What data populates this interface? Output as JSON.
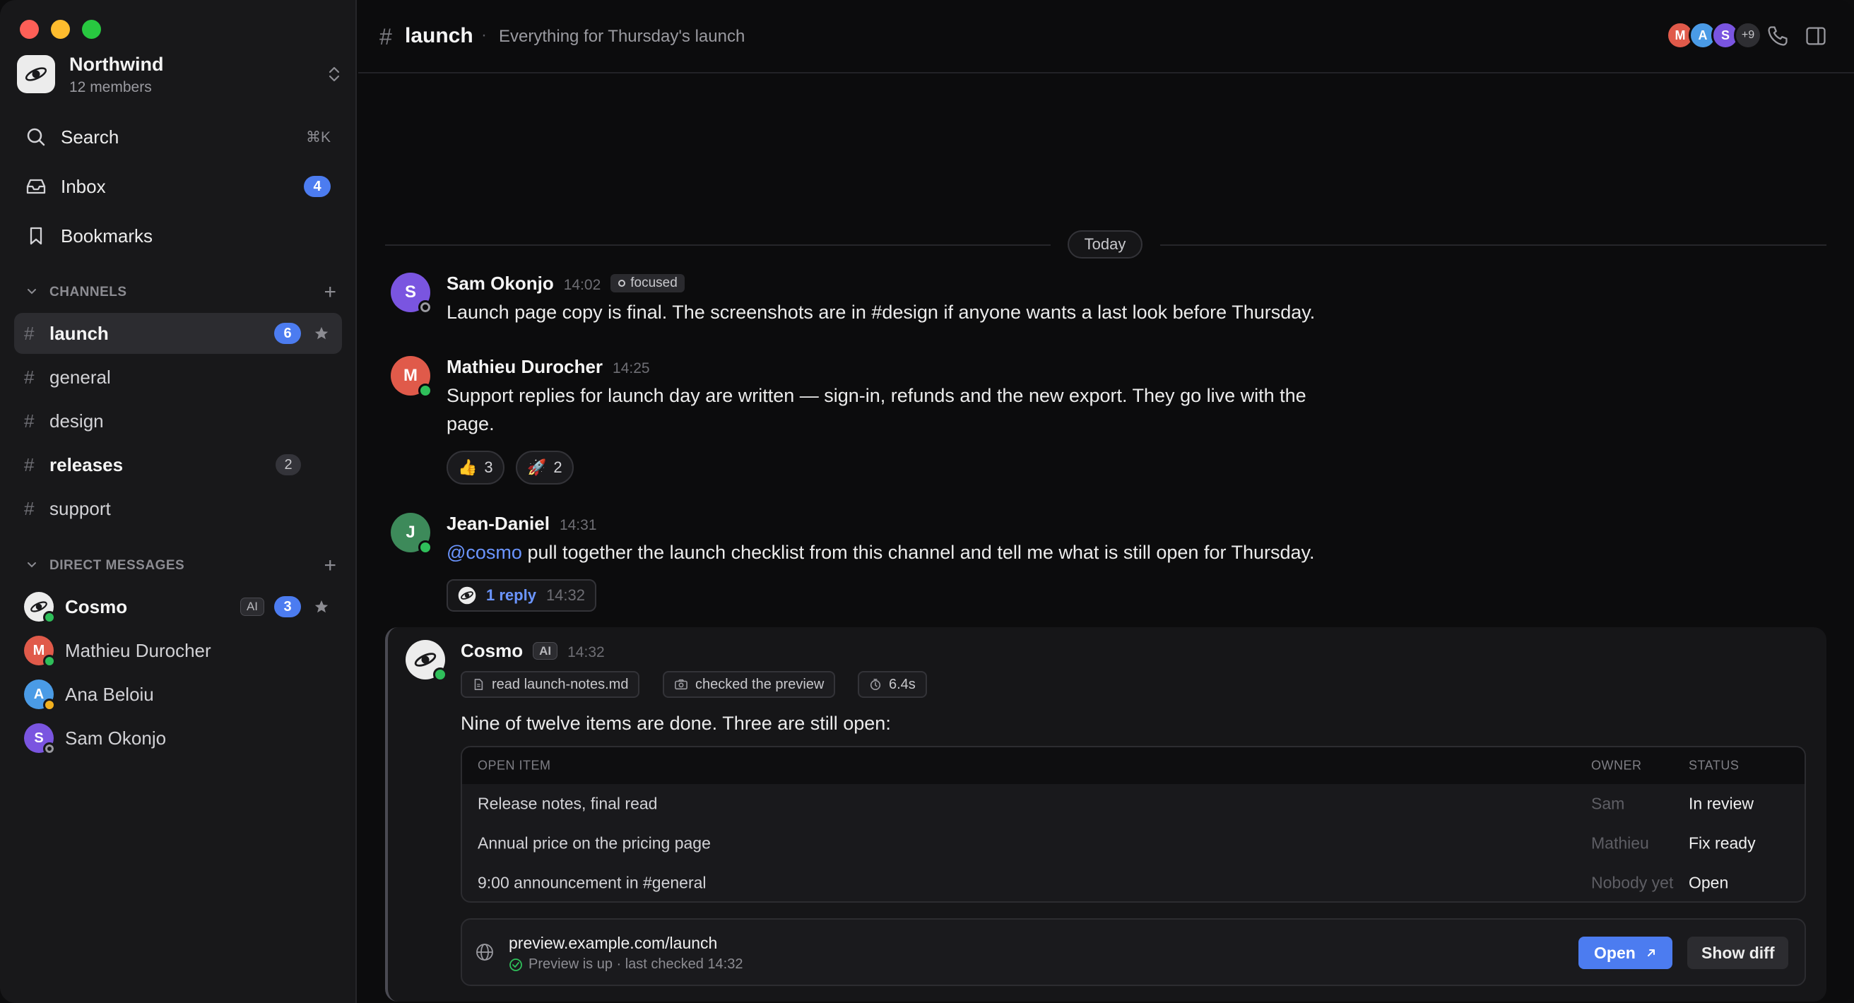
{
  "workspace": {
    "name": "Northwind",
    "members": "12 members"
  },
  "nav": {
    "search": {
      "label": "Search",
      "shortcut": "⌘K"
    },
    "inbox": {
      "label": "Inbox",
      "badge": "4"
    },
    "bookmarks": {
      "label": "Bookmarks"
    }
  },
  "channels_section": {
    "label": "CHANNELS"
  },
  "channels": [
    {
      "name": "launch",
      "badge": "6"
    },
    {
      "name": "general"
    },
    {
      "name": "design"
    },
    {
      "name": "releases",
      "count": "2"
    },
    {
      "name": "support"
    }
  ],
  "dm_section": {
    "label": "DIRECT MESSAGES"
  },
  "dms": [
    {
      "name": "Cosmo",
      "tag": "AI",
      "badge": "3"
    },
    {
      "name": "Mathieu Durocher",
      "initial": "M"
    },
    {
      "name": "Ana Beloiu",
      "initial": "A"
    },
    {
      "name": "Sam Okonjo",
      "initial": "S"
    }
  ],
  "header": {
    "hash": "#",
    "title": "launch",
    "dot": "·",
    "description": "Everything for Thursday's launch",
    "avatars": [
      "M",
      "A",
      "S"
    ],
    "more": "+9"
  },
  "divider": {
    "label": "Today"
  },
  "messages": [
    {
      "author": "Sam Okonjo",
      "initial": "S",
      "time": "14:02",
      "status": "focused",
      "text": "Launch page copy is final. The screenshots are in #design if anyone wants a last look before Thursday."
    },
    {
      "author": "Mathieu Durocher",
      "initial": "M",
      "time": "14:25",
      "text_line1": "Support replies for launch day are written — sign-in, refunds and the new export. They go live with the",
      "text_line2": "page.",
      "reactions": [
        {
          "emoji": "👍",
          "count": "3"
        },
        {
          "emoji": "🚀",
          "count": "2"
        }
      ]
    },
    {
      "author": "Jean-Daniel",
      "initial": "J",
      "time": "14:31",
      "mention": "@cosmo",
      "text": " pull together the launch checklist from this channel and tell me what is still open for Thursday.",
      "reply": {
        "label": "1 reply",
        "time": "14:32"
      }
    }
  ],
  "ai_message": {
    "author": "Cosmo",
    "tag": "AI",
    "time": "14:32",
    "tools": [
      "read launch-notes.md",
      "checked the preview",
      "6.4s"
    ],
    "text": "Nine of twelve items are done. Three are still open:",
    "table": {
      "headers": [
        "OPEN ITEM",
        "OWNER",
        "STATUS"
      ],
      "rows": [
        [
          "Release notes, final read",
          "Sam",
          "In review"
        ],
        [
          "Annual price on the pricing page",
          "Mathieu",
          "Fix ready"
        ],
        [
          "9:00 announcement in #general",
          "Nobody yet",
          "Open"
        ]
      ]
    },
    "preview": {
      "url": "preview.example.com/launch",
      "status": "Preview is up · last checked 14:32",
      "open_label": "Open",
      "diff_label": "Show diff"
    }
  },
  "colors": {
    "accent": "#4c7cf0",
    "mention": "#6b95ff",
    "online": "#2fbf5a",
    "away": "#f2b01e",
    "avatar_sam": "#7a55e0",
    "avatar_mathieu": "#e05a4a",
    "avatar_ana": "#4a9be6",
    "avatar_jean": "#3d8a5a"
  }
}
